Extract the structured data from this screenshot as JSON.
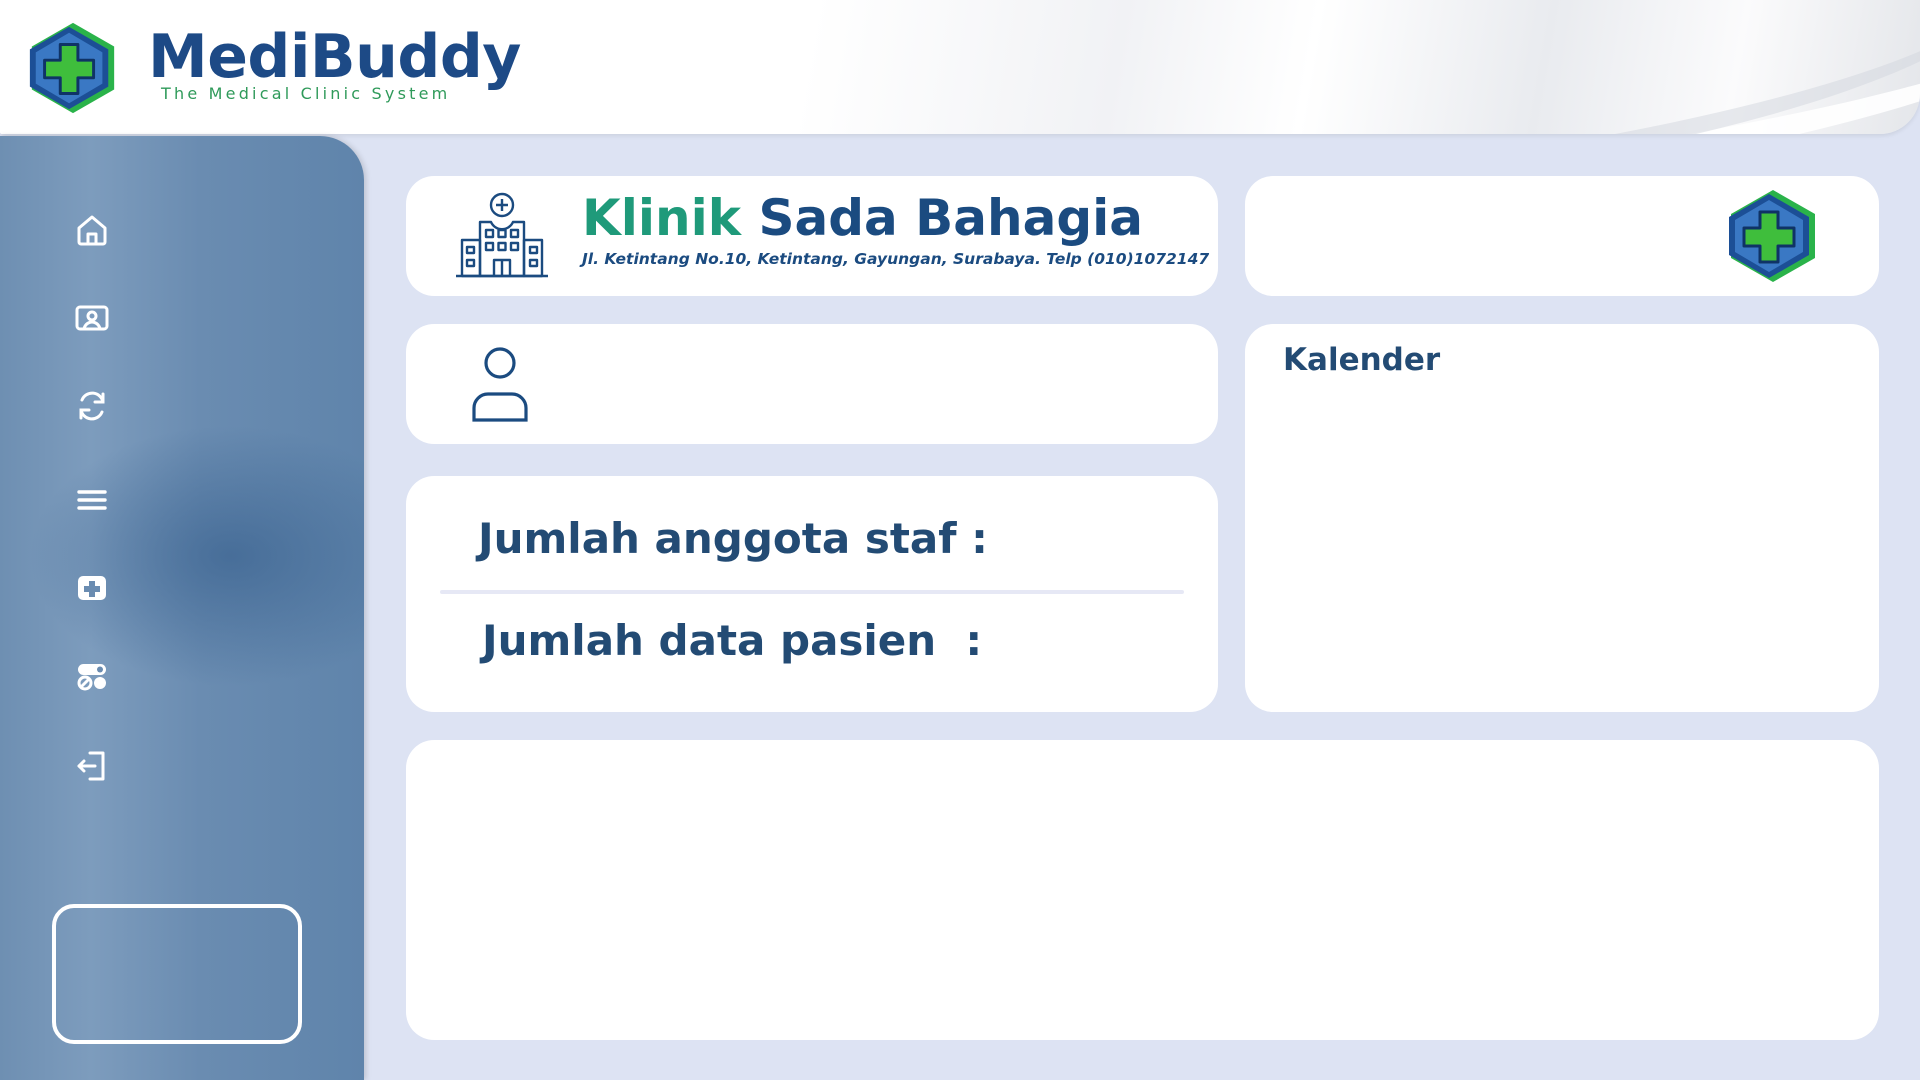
{
  "brand": {
    "name": "MediBuddy",
    "tagline": "The Medical Clinic System",
    "logo_icon": "medical-cross-hexagon-icon"
  },
  "sidebar": {
    "items": [
      {
        "icon": "home-icon"
      },
      {
        "icon": "id-card-icon"
      },
      {
        "icon": "refresh-icon"
      },
      {
        "icon": "menu-icon"
      },
      {
        "icon": "medical-plus-icon"
      },
      {
        "icon": "toggle-settings-icon"
      },
      {
        "icon": "logout-icon"
      }
    ]
  },
  "clinic": {
    "title_part1": "Klinik",
    "title_part2": "Sada Bahagia",
    "address": "Jl. Ketintang No.10, Ketintang, Gayungan, Surabaya. Telp (010)1072147",
    "icon": "hospital-building-icon"
  },
  "user": {
    "icon": "user-icon"
  },
  "stats": {
    "staff_label": "Jumlah anggota staf :",
    "patient_label": "Jumlah data pasien  :"
  },
  "calendar": {
    "title": "Kalender"
  },
  "colors": {
    "brand_blue": "#1d4a86",
    "brand_green": "#2f9a5a",
    "teal": "#1f9a7a",
    "background": "#dde3f3",
    "sidebar": "#6a8cb1"
  }
}
